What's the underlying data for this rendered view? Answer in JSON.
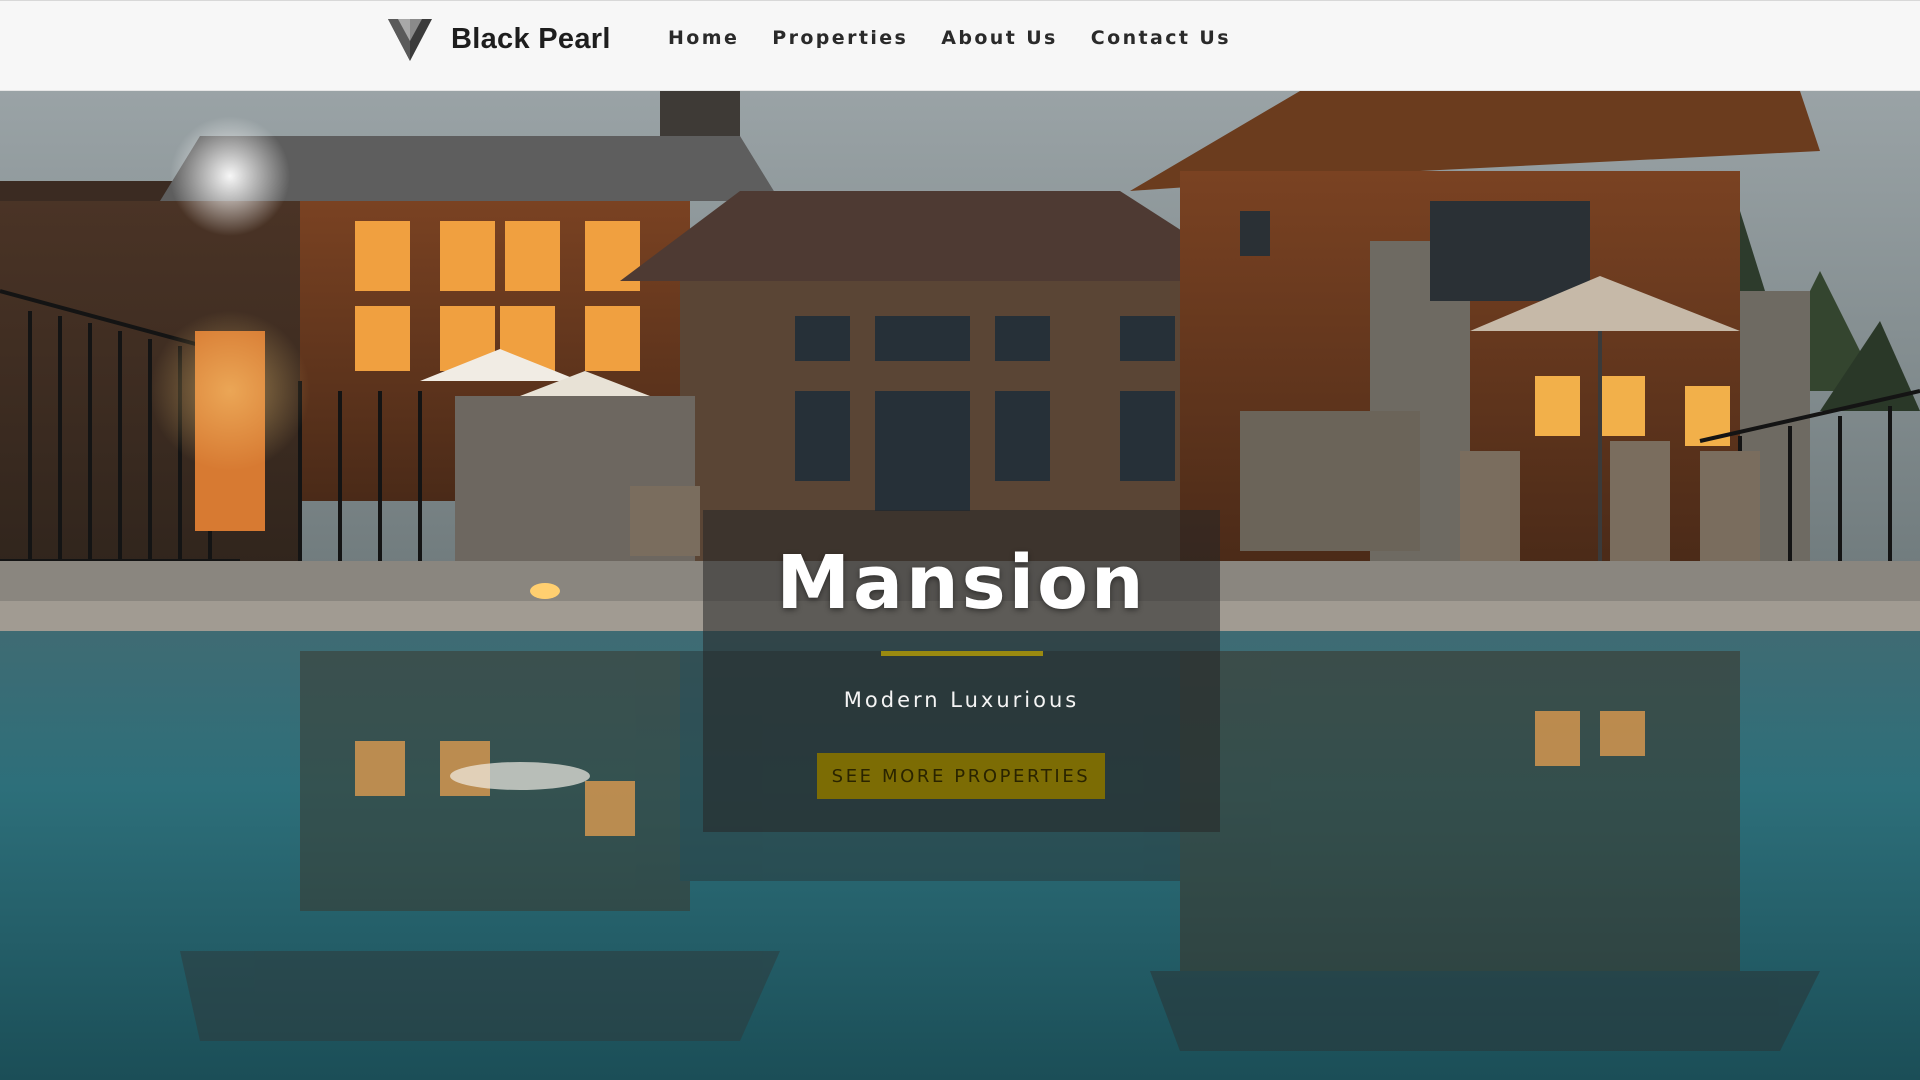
{
  "brand": {
    "name": "Black Pearl",
    "logo_icon": "inverted-triangle-gem-icon"
  },
  "nav": {
    "items": [
      "Home",
      "Properties",
      "About Us",
      "Contact Us"
    ]
  },
  "hero": {
    "title": "Mansion",
    "subtitle": "Modern Luxurious",
    "cta_label": "SEE MORE PROPERTIES",
    "background_image": "luxury wooden lodge with swimming pool at dusk"
  },
  "colors": {
    "accent": "#9a8a10",
    "cta_background": "#7c6c04",
    "nav_background": "#f7f7f7",
    "nav_text": "#2a2a2a"
  }
}
